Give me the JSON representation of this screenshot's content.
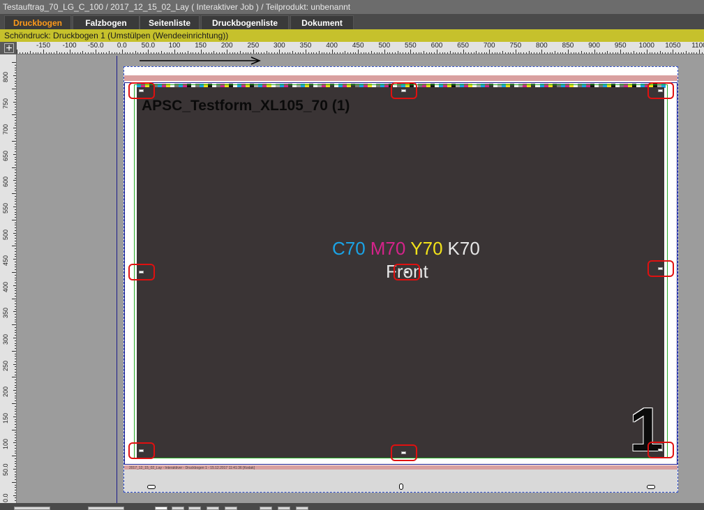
{
  "window": {
    "title": "Testauftrag_70_LG_C_100 / 2017_12_15_02_Lay ( Interaktiver Job ) / Teilprodukt: unbenannt"
  },
  "tabs": [
    {
      "label": "Druckbogen",
      "active": true
    },
    {
      "label": "Falzbogen",
      "active": false
    },
    {
      "label": "Seitenliste",
      "active": false
    },
    {
      "label": "Druckbogenliste",
      "active": false
    },
    {
      "label": "Dokument",
      "active": false
    }
  ],
  "sheet_info": "Schöndruck:  Druckbogen 1 (Umstülpen (Wendeeinrichtung))",
  "ruler": {
    "horizontal": [
      "-150",
      "-100",
      "-50.0",
      "0.0",
      "50.0",
      "100",
      "150",
      "200",
      "250",
      "300",
      "350",
      "400",
      "450",
      "500",
      "550",
      "600",
      "650",
      "700",
      "750",
      "800",
      "850",
      "900",
      "950",
      "1000",
      "1050",
      "1100"
    ],
    "vertical": [
      "800",
      "750",
      "700",
      "650",
      "600",
      "550",
      "500",
      "450",
      "400",
      "350",
      "300",
      "250",
      "200",
      "150",
      "100",
      "50.0",
      "0.0"
    ]
  },
  "sheet": {
    "form_title": "APSC_Testform_XL105_70 (1)",
    "cmyk": [
      {
        "label": "C70",
        "color": "#1aa3e6"
      },
      {
        "label": "M70",
        "color": "#d4238a"
      },
      {
        "label": "Y70",
        "color": "#f2e21a"
      },
      {
        "label": "K70",
        "color": "#e6e6e6"
      }
    ],
    "side_label": "Front",
    "sheet_number": "1",
    "slug_text": "2017_12_15_02_Lay - Interaktiver - Druckbogen 1 - 15.12.2017 11:41:36 [Kodak]"
  },
  "colors": {
    "active_tab": "#ff9a1a",
    "sheet_bar": "#c6c12c",
    "mark_outline": "#e01010",
    "sheet_background": "#3a3435"
  }
}
